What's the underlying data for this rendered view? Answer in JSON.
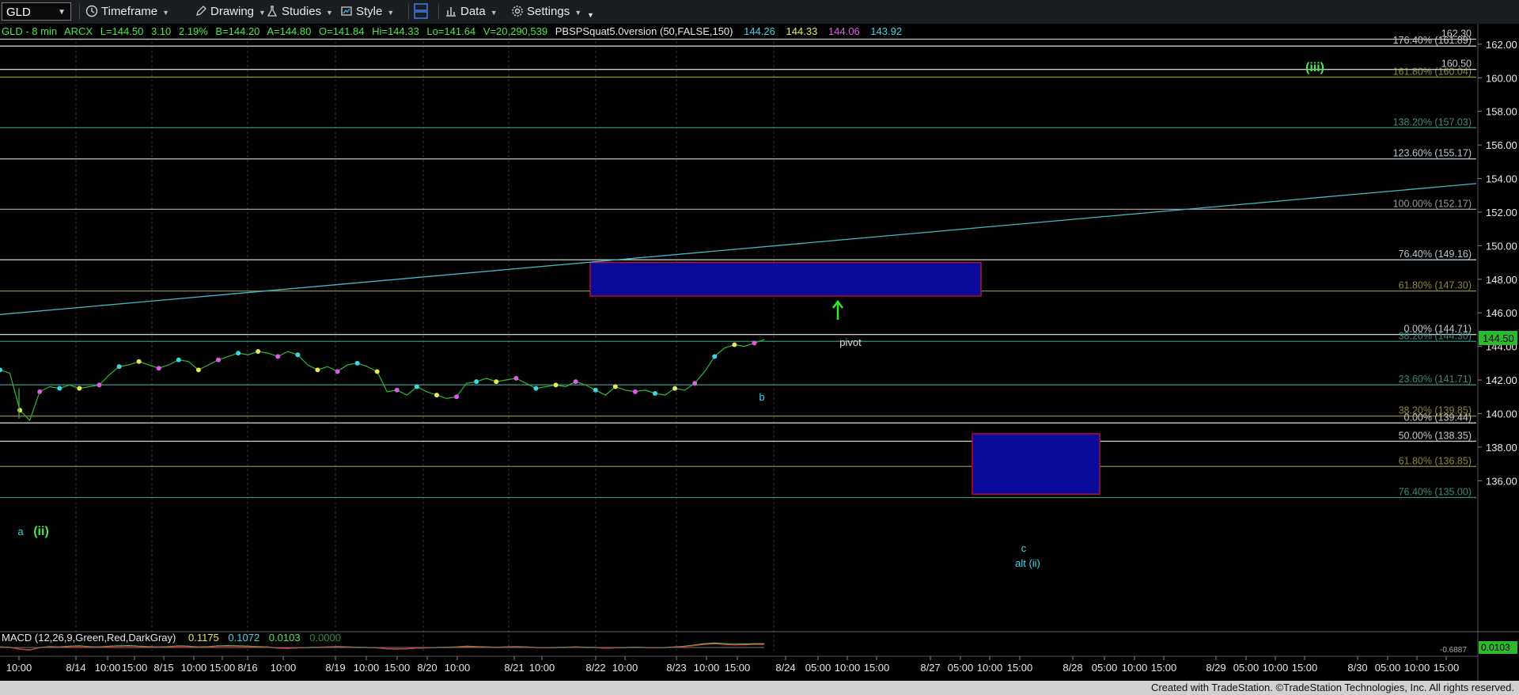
{
  "toolbar": {
    "symbol": "GLD",
    "items": [
      "Timeframe",
      "Drawing",
      "Studies",
      "Style",
      "Data",
      "Settings"
    ]
  },
  "header": {
    "title": "GLD - 8 min",
    "exchange": "ARCX",
    "last": "L=144.50",
    "change": "3.10",
    "pct": "2.19%",
    "bid": "B=144.20",
    "ask": "A=144.80",
    "open": "O=141.84",
    "high": "Hi=144.33",
    "low": "Lo=141.64",
    "volume": "V=20,290,539",
    "study": "PBSPSquat5.0version (50,FALSE,150)",
    "study_values": [
      "144.26",
      "144.33",
      "144.06",
      "143.92"
    ],
    "study_colors": [
      "#3fd6e8",
      "#e8e85a",
      "#e05ae8",
      "#3fd6e8"
    ]
  },
  "macd": {
    "label": "MACD (12,26,9,Green,Red,DarkGray)",
    "values": [
      "0.1175",
      "0.1072",
      "0.0103",
      "0.0000"
    ],
    "value_colors": [
      "#e8e85a",
      "#3fd6e8",
      "#4ce84c",
      "#2d8a2d"
    ],
    "axis_value": "0.0103",
    "axis_small": "-0.6887"
  },
  "footer": "Created with TradeStation. ©TradeStation Technologies, Inc. All rights reserved.",
  "chart_data": {
    "type": "line",
    "ylim": [
      134,
      163
    ],
    "y_ticks": [
      136,
      138,
      140,
      142,
      144,
      146,
      148,
      150,
      152,
      154,
      156,
      158,
      160,
      162
    ],
    "x_labels": [
      "10:00",
      "8/14",
      "10:00",
      "15:00",
      "8/15",
      "10:00",
      "15:00",
      "8/16",
      "10:00",
      "8/19",
      "10:00",
      "15:00",
      "8/20",
      "10:00",
      "8/21",
      "10:00",
      "8/22",
      "10:00",
      "8/23",
      "10:00",
      "15:00",
      "8/24",
      "05:00",
      "10:00",
      "15:00",
      "8/27",
      "05:00",
      "10:00",
      "15:00",
      "8/28",
      "05:00",
      "10:00",
      "15:00",
      "8/29",
      "05:00",
      "10:00",
      "15:00",
      "8/30",
      "05:00",
      "10:00",
      "15:00"
    ],
    "last_price": "144.50",
    "fib_levels": [
      {
        "label": "176.40% (161.89)",
        "value": 161.89,
        "color": "#c8c8c8"
      },
      {
        "label": "161.80% (160.04)",
        "value": 160.04,
        "color": "#8a8a3a"
      },
      {
        "label": "138.20% (157.03)",
        "value": 157.03,
        "color": "#3a8a7a"
      },
      {
        "label": "123.60% (155.17)",
        "value": 155.17,
        "color": "#b8c4d0"
      },
      {
        "label": "100.00% (152.17)",
        "value": 152.17,
        "color": "#9a9a9a"
      },
      {
        "label": "76.40% (149.16)",
        "value": 149.16,
        "color": "#b8c4d0"
      },
      {
        "label": "61.80% (147.30)",
        "value": 147.3,
        "color": "#8a8a3a"
      },
      {
        "label": "0.00% (144.71)",
        "value": 144.71,
        "color": "#c8c8c8"
      },
      {
        "label": "38.20% (144.30)",
        "value": 144.3,
        "color": "#3a8a7a"
      },
      {
        "label": "23.60% (141.71)",
        "value": 141.71,
        "color": "#3a8a7a"
      },
      {
        "label": "38.20% (139.85)",
        "value": 139.85,
        "color": "#8a8a3a"
      },
      {
        "label": "0.00% (139.44)",
        "value": 139.44,
        "color": "#c8c8c8"
      },
      {
        "label": "50.00% (138.35)",
        "value": 138.35,
        "color": "#c8c8c8"
      },
      {
        "label": "61.80% (136.85)",
        "value": 136.85,
        "color": "#8a8a3a"
      },
      {
        "label": "76.40% (135.00)",
        "value": 135.0,
        "color": "#3a8a7a"
      }
    ],
    "price_lines": [
      {
        "label": "162.30",
        "value": 162.3
      },
      {
        "label": "160.50",
        "value": 160.5
      }
    ],
    "annotations": [
      {
        "text": "(iii)",
        "color": "#4ce84c"
      },
      {
        "text": "pivot",
        "color": "#dddddd"
      },
      {
        "text": "b",
        "color": "#3fd6e8"
      },
      {
        "text": "a",
        "color": "#3fd6e8"
      },
      {
        "text": "(ii)",
        "color": "#4ce84c"
      },
      {
        "text": "c",
        "color": "#3fd6e8"
      },
      {
        "text": "alt (ii)",
        "color": "#3fd6e8"
      }
    ],
    "pivot_zone": [
      147.0,
      149.0
    ],
    "alt_zone": [
      135.2,
      138.8
    ],
    "trendline": [
      145.9,
      153.7
    ],
    "price_series": [
      142.6,
      142.4,
      140.2,
      139.6,
      141.3,
      141.6,
      141.5,
      141.7,
      141.5,
      141.6,
      141.7,
      142.3,
      142.8,
      142.9,
      143.1,
      142.9,
      142.7,
      142.9,
      143.2,
      143.1,
      142.6,
      142.9,
      143.2,
      143.4,
      143.6,
      143.5,
      143.7,
      143.6,
      143.4,
      143.7,
      143.5,
      142.9,
      142.6,
      142.8,
      142.5,
      142.9,
      143.0,
      142.8,
      142.5,
      141.3,
      141.4,
      141.1,
      141.6,
      141.3,
      141.1,
      140.9,
      141.0,
      141.8,
      141.9,
      142.1,
      141.9,
      142.0,
      142.1,
      141.8,
      141.5,
      141.6,
      141.7,
      141.6,
      141.9,
      141.7,
      141.4,
      141.1,
      141.6,
      141.4,
      141.3,
      141.4,
      141.2,
      141.1,
      141.5,
      141.4,
      141.8,
      142.5,
      143.4,
      143.9,
      144.1,
      144.0,
      144.2,
      144.4
    ],
    "macd_series": [
      0.02,
      0.01,
      -0.05,
      -0.08,
      0.0,
      0.03,
      0.02,
      0.04,
      0.05,
      0.03,
      0.02,
      0.04,
      0.05,
      0.06,
      0.04,
      0.03,
      0.02,
      0.03,
      0.05,
      0.04,
      0.02,
      0.03,
      0.05,
      0.06,
      0.05,
      0.04,
      0.03,
      0.02,
      -0.02,
      -0.03,
      -0.01,
      0.0,
      0.01,
      0.02,
      0.03,
      0.02,
      0.01,
      0.0,
      -0.01,
      -0.04,
      -0.05,
      -0.04,
      -0.02,
      -0.01,
      0.0,
      0.01,
      0.02,
      0.04,
      0.03,
      0.02,
      0.01,
      0.02,
      0.03,
      0.02,
      0.0,
      -0.01,
      0.0,
      0.01,
      0.02,
      0.01,
      0.0,
      -0.02,
      -0.01,
      0.0,
      0.01,
      0.0,
      -0.01,
      0.0,
      0.02,
      0.04,
      0.08,
      0.12,
      0.14,
      0.12,
      0.1,
      0.11,
      0.12,
      0.12
    ]
  }
}
